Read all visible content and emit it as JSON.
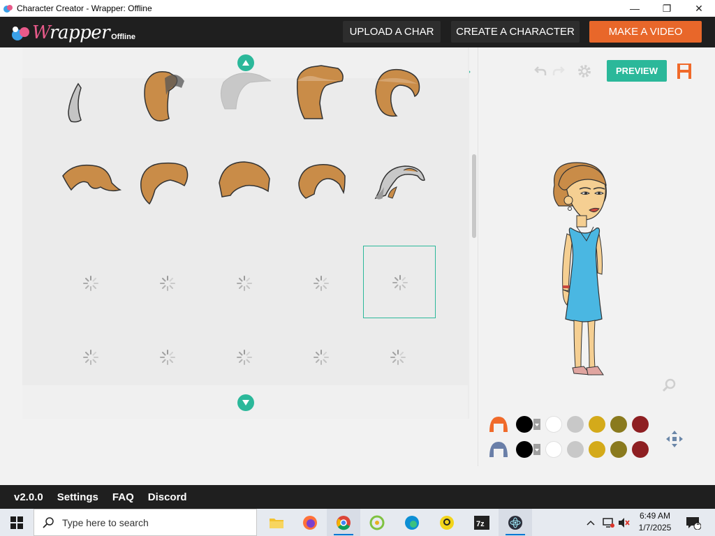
{
  "window": {
    "title": "Character Creator - Wrapper: Offline",
    "minimize": "—",
    "restore": "❐",
    "close": "✕"
  },
  "header": {
    "logo_w": "W",
    "logo_rest": "rapper",
    "logo_sub": "Offline",
    "upload_label": "UPLOAD A CHAR",
    "create_label": "CREATE A CHARACTER",
    "video_label": "MAKE A VIDEO",
    "accent_orange": "#e8672a",
    "accent_teal": "#2bb89a"
  },
  "toolbar": {
    "categories": [
      {
        "name": "upper-body-icon",
        "active": false
      },
      {
        "name": "lower-body-icon",
        "active": false
      },
      {
        "name": "face-shape-icon",
        "active": false
      },
      {
        "name": "hair-icon",
        "active": true
      },
      {
        "name": "facial-hair-icon",
        "active": false
      },
      {
        "name": "mouth-icon",
        "active": false
      },
      {
        "name": "ear-icon",
        "active": false
      },
      {
        "name": "eye-shape-icon",
        "active": false
      },
      {
        "name": "eye-icon",
        "active": false
      },
      {
        "name": "eyebrow-icon",
        "active": false
      },
      {
        "name": "nose-icon",
        "active": false
      },
      {
        "name": "glasses-icon",
        "active": false
      },
      {
        "name": "face-mark-icon",
        "active": false
      }
    ],
    "preview_label": "PREVIEW"
  },
  "grid": {
    "rows": 5,
    "cols": 5,
    "loaded_items": 10,
    "selected_index": 14
  },
  "colors": {
    "row1": [
      "#000000",
      "#ffffff",
      "#c8c8c8",
      "#d4aa1a",
      "#8a7a1e",
      "#8e1f22"
    ],
    "row2": [
      "#000000",
      "#ffffff",
      "#c8c8c8",
      "#d4aa1a",
      "#8a7a1e",
      "#8e1f22"
    ]
  },
  "footer": {
    "version": "v2.0.0",
    "settings": "Settings",
    "faq": "FAQ",
    "discord": "Discord"
  },
  "taskbar": {
    "search_placeholder": "Type here to search",
    "time": "6:49 AM",
    "date": "1/7/2025",
    "notification_count": "1"
  }
}
